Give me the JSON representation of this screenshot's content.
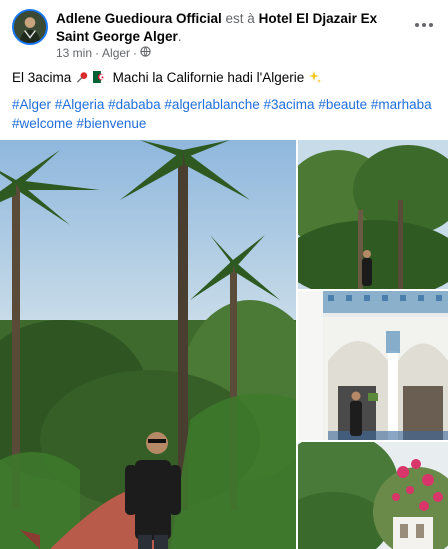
{
  "post": {
    "author": "Adlene Guedioura Official",
    "at_text": "est à",
    "place": "Hotel El Djazair Ex Saint George Alger",
    "time": "13 min",
    "location": "Alger",
    "privacy_icon": "globe-icon",
    "more_icon": "more-options-icon"
  },
  "caption": {
    "part1": "El 3acima",
    "part2": "Machi la Californie hadi l'Algerie"
  },
  "hashtags": [
    "#Alger",
    "#Algeria",
    "#dababa",
    "#algerlablanche",
    "#3acima",
    "#beaute",
    "#marhaba",
    "#welcome",
    "#bienvenue"
  ],
  "colors": {
    "link": "#216fdb",
    "muted": "#65676b",
    "avatar_ring": "#1877f2"
  }
}
